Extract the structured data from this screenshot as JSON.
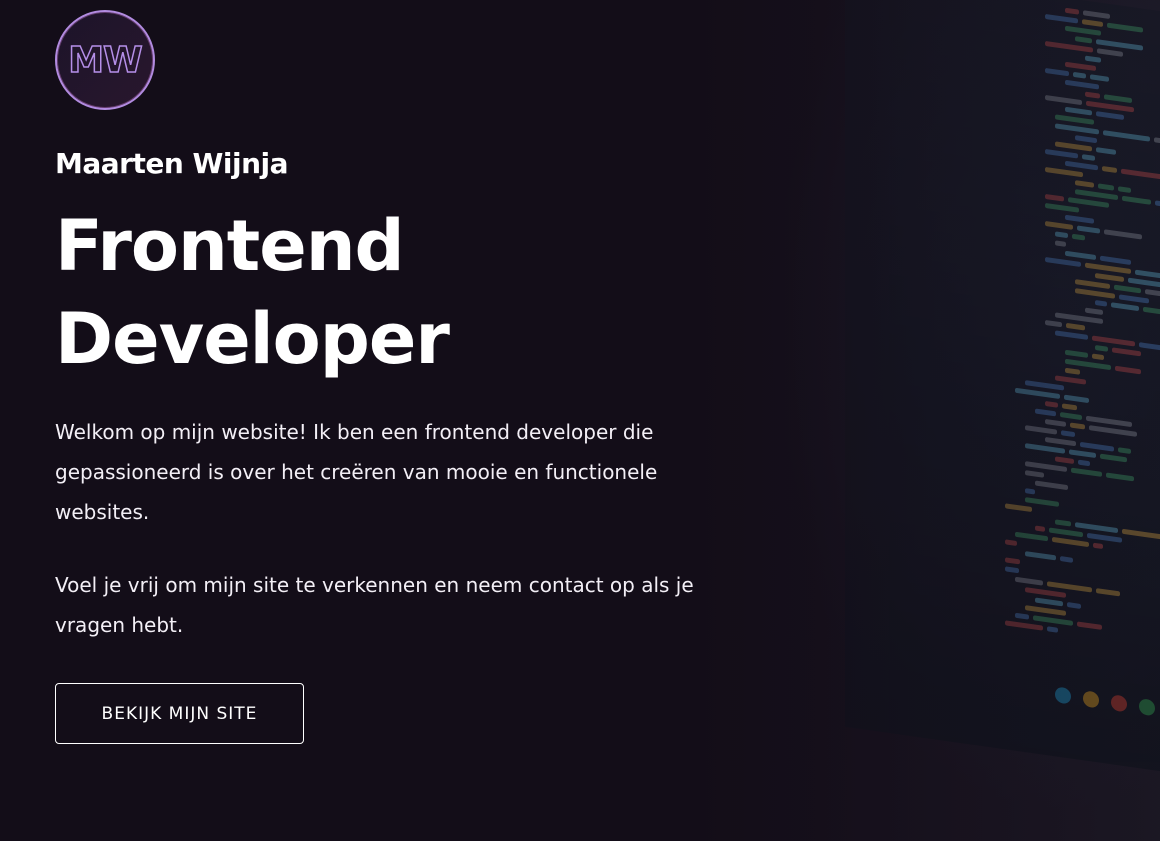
{
  "logo": {
    "initials": "MW"
  },
  "hero": {
    "name": "Maarten Wijnja",
    "headline_line1": "Frontend",
    "headline_line2": "Developer",
    "intro_paragraph": "Welkom op mijn website! Ik ben een frontend developer die gepassioneerd is over het creëren van mooie en functionele websites.",
    "invite_paragraph": "Voel je vrij om mijn site te verkennen en neem contact op als je vragen hebt.",
    "cta_label": "BEKIJK MIJN SITE"
  },
  "colors": {
    "background": "#130d18",
    "text": "#ffffff",
    "logo_accent": "#b58fe8"
  }
}
